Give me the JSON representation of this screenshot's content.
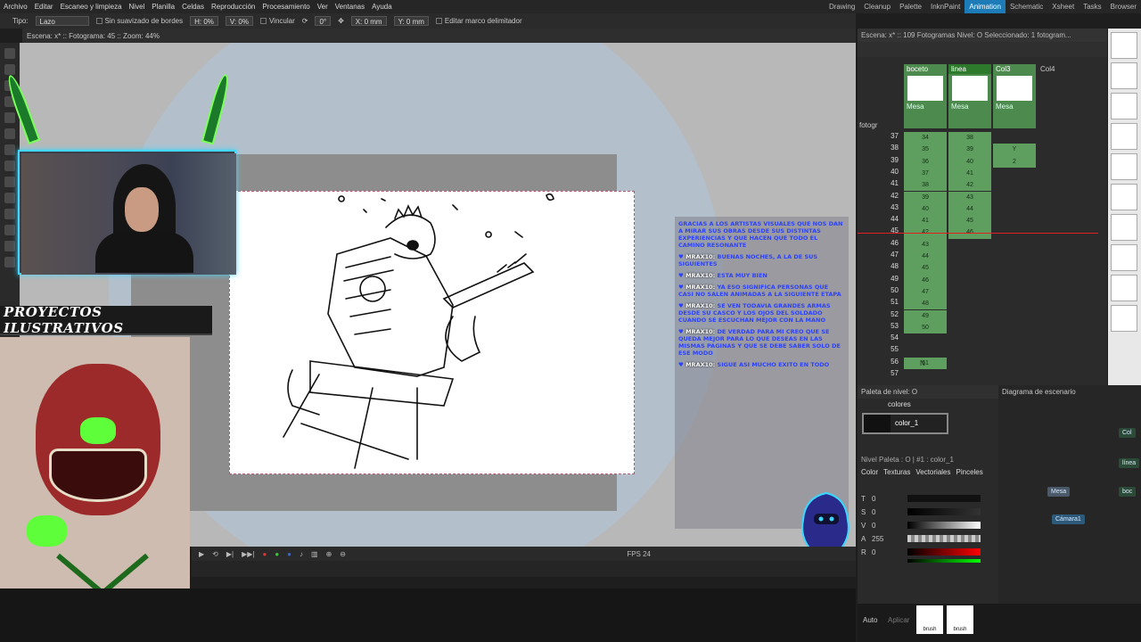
{
  "menu": [
    "Archivo",
    "Editar",
    "Escaneo y limpieza",
    "Nivel",
    "Planilla",
    "Celdas",
    "Reproducción",
    "Procesamiento",
    "Ver",
    "Ventanas",
    "Ayuda"
  ],
  "rooms": [
    "Drawing",
    "Cleanup",
    "Palette",
    "InknPaint",
    "Animation",
    "Schematic",
    "Xsheet",
    "Tasks",
    "Browser"
  ],
  "active_room": "Animation",
  "tool_options": {
    "tipo_label": "Tipo:",
    "tipo_value": "Lazo",
    "antialias": "Sin suavizado de bordes",
    "h": "H: 0%",
    "v": "V: 0%",
    "link": "Vincular",
    "angle": "0°",
    "x": "X: 0 mm",
    "y": "Y: 0 mm",
    "edit_bbox": "Editar marco delimitador"
  },
  "viewer_header": "Escena: x* :: Fotograma: 45 :: Zoom: 44%",
  "banner": "PROYECTOS ILUSTRATIVOS",
  "chat": [
    {
      "text": "GRACIAS A LOS ARTISTAS VISUALES QUE NOS DAN A MIRAR SUS OBRAS DESDE SUS DISTINTAS EXPERIENCIAS Y QUE HACEN QUE TODO EL CAMINO RESONANTE"
    },
    {
      "user": "MRAX10:",
      "text": "BUENAS NOCHES, A LA DE SUS SIGUIENTES"
    },
    {
      "user": "MRAX10:",
      "text": "ESTA MUY BIEN"
    },
    {
      "user": "MRAX10:",
      "text": "YA ESO SIGNIFICA PERSONAS QUE CASI NO SALEN ANIMADAS A LA SIGUIENTE ETAPA"
    },
    {
      "user": "MRAX10:",
      "text": "SE VEN TODAVIA GRANDES ARMAS DESDE SU CASCO Y LOS OJOS DEL SOLDADO CUANDO SE ESCUCHAN MEJOR CON LA MANO"
    },
    {
      "user": "MRAX10:",
      "text": "DE VERDAD PARA MI CREO QUE SE QUEDA MEJOR PARA LO QUE DESEAS EN LAS MISMAS PAGINAS Y QUE SE DEBE SABER SOLO DE ESE MODO"
    },
    {
      "user": "MRAX10:",
      "text": "SIGUE ASI MUCHO EXITO EN TODO"
    }
  ],
  "playbar": {
    "fps": "FPS 24",
    "frame": "24"
  },
  "xsheet": {
    "header": "Escena: x* :: 109 Fotogramas  Nivel: O  Seleccionado: 1 fotogram...",
    "columns": [
      "boceto",
      "linea",
      "Col3",
      "Col4"
    ],
    "col_sub": [
      "Mesa",
      "Mesa",
      "Mesa"
    ],
    "camera": "Cámara1",
    "frame_label": "fotogr",
    "rows": [
      "37",
      "38",
      "39",
      "40",
      "41",
      "42",
      "43",
      "44",
      "45",
      "46",
      "47",
      "48",
      "49",
      "50",
      "51",
      "52",
      "53",
      "54",
      "55",
      "56",
      "57"
    ],
    "boceto": [
      "34",
      "35",
      "36",
      "37",
      "38",
      "39",
      "40",
      "41",
      "42",
      "43",
      "44",
      "45",
      "46",
      "47",
      "48",
      "49",
      "50",
      "",
      "",
      "51",
      ""
    ],
    "linea": [
      "38",
      "39",
      "40",
      "41",
      "42",
      "43",
      "44",
      "45",
      "46",
      "",
      "",
      "",
      "",
      "",
      "",
      "",
      "",
      "",
      "",
      "",
      ""
    ],
    "col3": [
      "",
      "Y",
      "2",
      "",
      "",
      "",
      "",
      "",
      "",
      "",
      "",
      "",
      "",
      "",
      "",
      "",
      "",
      "",
      "",
      "",
      ""
    ],
    "n_marker": "N",
    "current_row": "45"
  },
  "palette": {
    "title": "Paleta de nivel: O",
    "tab": "colores",
    "style": "color_1",
    "level_palette": "Nivel Paleta : O | #1 : color_1",
    "tabs": [
      "Color",
      "Texturas",
      "Vectoriales",
      "Pinceles"
    ],
    "channels": [
      {
        "k": "T",
        "v": "0"
      },
      {
        "k": "S",
        "v": "0"
      },
      {
        "k": "V",
        "v": "0"
      },
      {
        "k": "A",
        "v": "255"
      },
      {
        "k": "R",
        "v": "0"
      }
    ],
    "auto": "Auto",
    "apply": "Aplicar",
    "brush1": "brush",
    "brush2": "brush"
  },
  "schematic": {
    "title": "Diagrama de escenario",
    "mesa": "Mesa",
    "camera": "Cámara1",
    "n1": "Col",
    "n2": "línea",
    "n3": "boc"
  }
}
